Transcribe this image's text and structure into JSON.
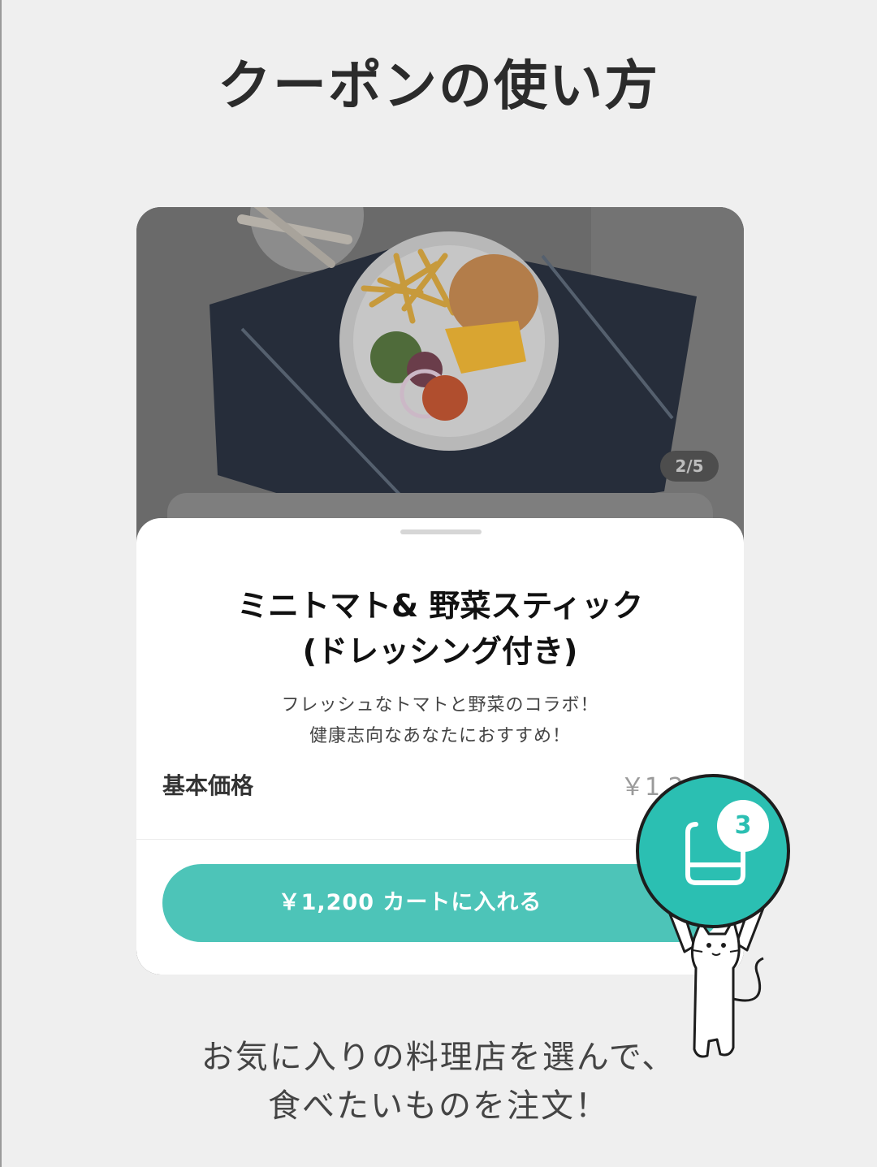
{
  "page": {
    "title": "クーポンの使い方"
  },
  "product": {
    "image_counter": "2/5",
    "name_line1": "ミニトマト& 野菜スティック",
    "name_line2": "(ドレッシング付き)",
    "description_line1": "フレッシュなトマトと野菜のコラボ！",
    "description_line2": "健康志向なあなたにおすすめ！",
    "price_label": "基本価格",
    "price_value": "￥1,2",
    "add_to_cart_label": "￥1,200  カートに入れる"
  },
  "cart": {
    "count": "3"
  },
  "caption": {
    "line1": "お気に入りの料理店を選んで、",
    "line2": "食べたいものを注文！"
  },
  "colors": {
    "accent": "#4dc4b8",
    "cart_circle": "#2bbfb2",
    "background": "#efefef"
  },
  "icons": [
    "cart-icon",
    "cat-mascot"
  ]
}
